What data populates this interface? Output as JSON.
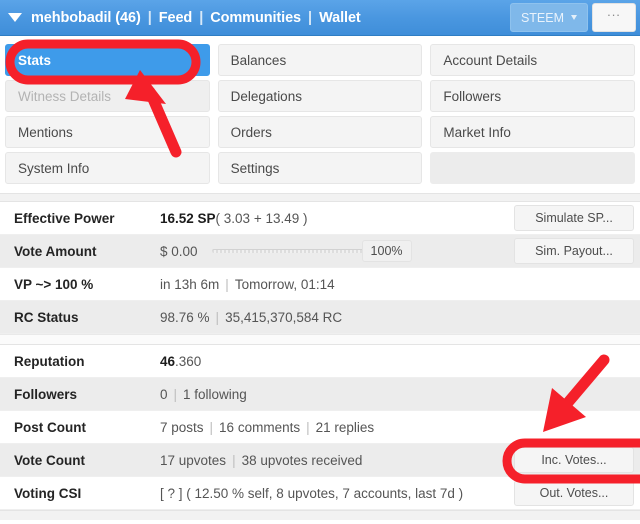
{
  "header": {
    "caret_icon": "caret-down-icon",
    "username": "mehbobadil (46)",
    "separator": "|",
    "links": [
      "Feed",
      "Communities",
      "Wallet"
    ],
    "chain_label": "STEEM",
    "chain_caret_icon": "chevron-down-icon",
    "more_label": "...",
    "bg_color": "#4a97e0",
    "accent_color": "#3e9bea"
  },
  "tabs": [
    {
      "label": "Stats",
      "state": "active"
    },
    {
      "label": "Balances",
      "state": "normal"
    },
    {
      "label": "Account Details",
      "state": "normal"
    },
    {
      "label": "Witness Details",
      "state": "disabled"
    },
    {
      "label": "Delegations",
      "state": "normal"
    },
    {
      "label": "Followers",
      "state": "normal"
    },
    {
      "label": "Mentions",
      "state": "normal"
    },
    {
      "label": "Orders",
      "state": "normal"
    },
    {
      "label": "Market Info",
      "state": "normal"
    },
    {
      "label": "System Info",
      "state": "normal"
    },
    {
      "label": "Settings",
      "state": "normal"
    },
    {
      "label": "",
      "state": "empty"
    }
  ],
  "stats_top": [
    {
      "label": "Effective Power",
      "value_bold": "16.52 SP",
      "value_rest": " ( 3.03 + 13.49 )",
      "action": "Simulate SP..."
    },
    {
      "label": "Vote Amount",
      "value_bold": "$ 0.00",
      "value_rest": "",
      "slider_value": "100%",
      "action": "Sim. Payout..."
    },
    {
      "label": "VP ~> 100 %",
      "value_bold": "",
      "value_rest": "in 13h 6m | Tomorrow, 01:14",
      "parts": [
        "in 13h 6m",
        "Tomorrow, 01:14"
      ],
      "action": ""
    },
    {
      "label": "RC Status",
      "value_bold": "",
      "value_rest": "98.76 % | 35,415,370,584 RC",
      "parts": [
        "98.76 %",
        "35,415,370,584 RC"
      ],
      "action": ""
    }
  ],
  "stats_bottom": [
    {
      "label": "Reputation",
      "value_bold": "46",
      "value_rest": ".360",
      "action": ""
    },
    {
      "label": "Followers",
      "value_bold": "",
      "value_rest": "0 | 1 following",
      "parts": [
        "0",
        "1 following"
      ],
      "action": ""
    },
    {
      "label": "Post Count",
      "value_bold": "",
      "value_rest": "7 posts | 16 comments | 21 replies",
      "parts": [
        "7 posts",
        "16 comments",
        "21 replies"
      ],
      "action": ""
    },
    {
      "label": "Vote Count",
      "value_bold": "",
      "value_rest": "17 upvotes | 38 upvotes received",
      "parts": [
        "17 upvotes",
        "38 upvotes received"
      ],
      "action": "Inc. Votes..."
    },
    {
      "label": "Voting CSI",
      "value_bold": "",
      "value_rest": "[ ? ] ( 12.50 % self, 8 upvotes, 7 accounts, last 7d )",
      "action": "Out. Votes..."
    }
  ],
  "annotations": {
    "color": "#f5202a",
    "ellipse_stats_target": "Stats",
    "ellipse_votes_target": "Inc. Votes...",
    "arrow_to_stats": "arrow-up-icon",
    "arrow_to_votes": "arrow-down-left-icon"
  }
}
